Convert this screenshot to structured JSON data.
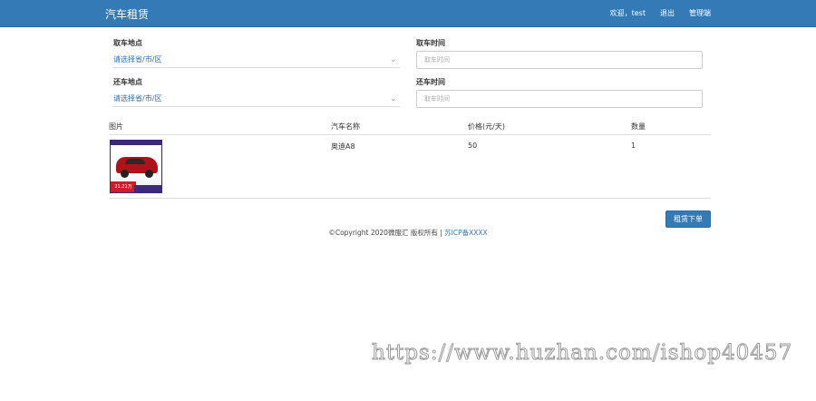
{
  "navbar": {
    "brand": "汽车租赁",
    "welcome": "欢迎，test",
    "logout": "退出",
    "admin": "管理端"
  },
  "form": {
    "pickup_location_label": "取车地点",
    "pickup_location_value": "请选择省/市/区",
    "pickup_time_label": "取车时间",
    "pickup_time_placeholder": "取车时间",
    "return_location_label": "还车地点",
    "return_location_value": "请选择省/市/区",
    "return_time_label": "还车时间",
    "return_time_placeholder": "取车时间"
  },
  "table": {
    "headers": [
      "图片",
      "汽车名称",
      "价格(元/天)",
      "数量"
    ],
    "rows": [
      {
        "name": "奥迪A8",
        "price": "50",
        "quantity": "1",
        "image_price_text": "21.21万"
      }
    ]
  },
  "order_button": "租赁下单",
  "footer": {
    "copyright": "©Copyright 2020微服汇 版权所有 | ",
    "icp": "苏ICP备XXXX"
  },
  "watermark": "https://www.huzhan.com/ishop40457",
  "colors": {
    "primary": "#337ab7",
    "link": "#2f71b7"
  }
}
